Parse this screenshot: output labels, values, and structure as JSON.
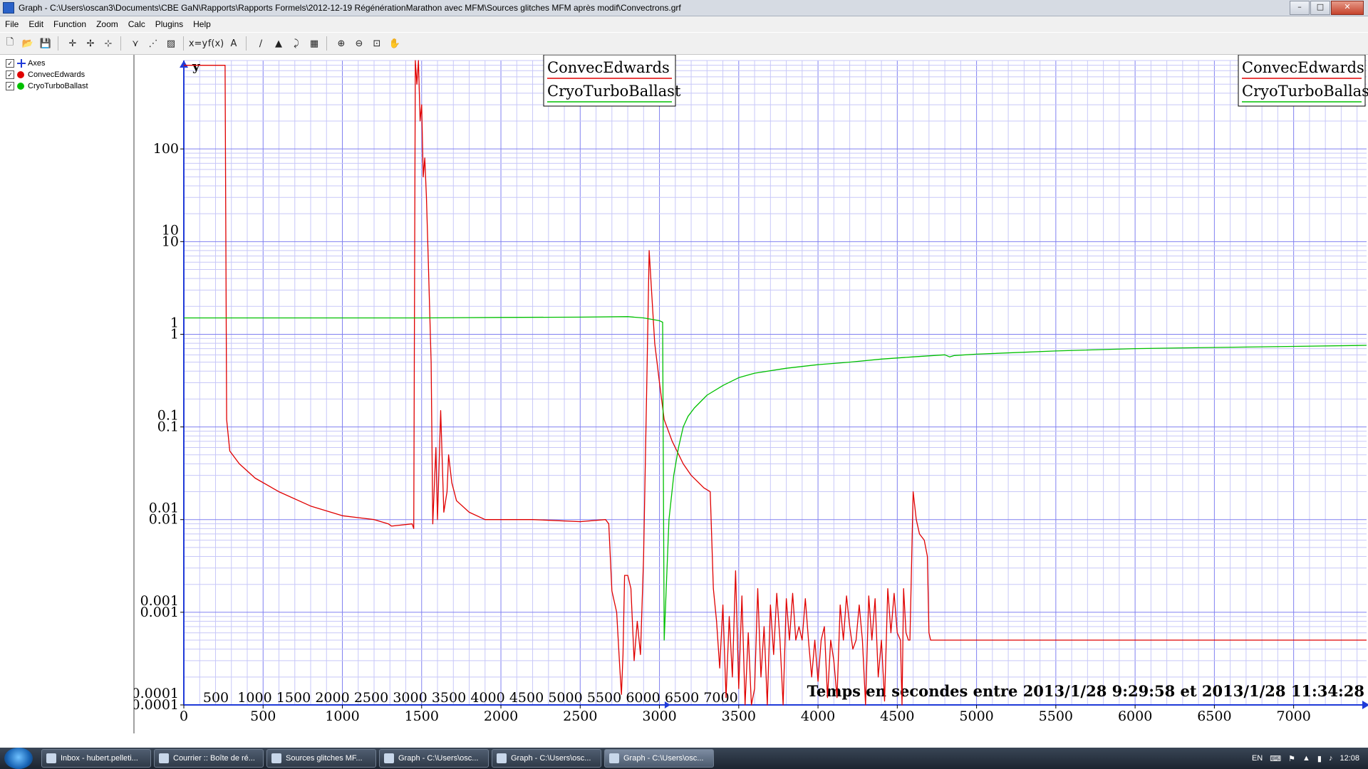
{
  "window": {
    "title": "Graph - C:\\Users\\oscan3\\Documents\\CBE GaN\\Rapports\\Rapports Formels\\2012-12-19 RégénérationMarathon avec MFM\\Sources glitches MFM après modif\\Convectrons.grf",
    "minimize": "–",
    "maximize": "□",
    "close": "✕"
  },
  "menu": [
    "File",
    "Edit",
    "Function",
    "Zoom",
    "Calc",
    "Plugins",
    "Help"
  ],
  "toolbar": {
    "groups": [
      [
        {
          "icon": "new-file-icon",
          "glyph": "🗋"
        },
        {
          "icon": "open-file-icon",
          "glyph": "📂"
        },
        {
          "icon": "save-icon",
          "glyph": "💾"
        }
      ],
      [
        {
          "icon": "insert-function-icon",
          "glyph": "✛"
        },
        {
          "icon": "insert-tangent-icon",
          "glyph": "✢"
        },
        {
          "icon": "insert-point-series-icon",
          "glyph": "⊹"
        }
      ],
      [
        {
          "icon": "edit-icon",
          "glyph": "⋎"
        },
        {
          "icon": "delete-icon",
          "glyph": "⋰"
        },
        {
          "icon": "shade-icon",
          "glyph": "▨"
        }
      ],
      [
        {
          "icon": "evaluate-icon",
          "glyph": "x=y"
        },
        {
          "icon": "table-icon",
          "glyph": "f(x)"
        },
        {
          "icon": "label-icon",
          "glyph": "A"
        }
      ],
      [
        {
          "icon": "trendline-icon",
          "glyph": "∕"
        },
        {
          "icon": "area-icon",
          "glyph": "▲"
        },
        {
          "icon": "measure-icon",
          "glyph": "⤸"
        },
        {
          "icon": "grid-table-icon",
          "glyph": "▦"
        }
      ],
      [
        {
          "icon": "zoom-in-icon",
          "glyph": "⊕"
        },
        {
          "icon": "zoom-out-icon",
          "glyph": "⊖"
        },
        {
          "icon": "zoom-square-icon",
          "glyph": "⊡"
        },
        {
          "icon": "move-hand-icon",
          "glyph": "✋"
        }
      ]
    ]
  },
  "function_list": [
    {
      "label": "Axes",
      "checked": true,
      "marker": "axes",
      "color": "#1f3ad8"
    },
    {
      "label": "ConvecEdwards",
      "checked": true,
      "marker": "dot",
      "color": "#e00000"
    },
    {
      "label": "CryoTurboBallast",
      "checked": true,
      "marker": "dot",
      "color": "#00c000"
    }
  ],
  "chart_data": {
    "type": "line",
    "y_axis_name": "y",
    "y_scale": "log",
    "ylim": [
      0.0001,
      900
    ],
    "xlim": [
      0,
      7460
    ],
    "x_ticks": [
      0,
      500,
      1000,
      1500,
      2000,
      2500,
      3000,
      3500,
      4000,
      4500,
      5000,
      5500,
      6000,
      6500,
      7000
    ],
    "y_tick_labels": [
      "100",
      "10",
      "1",
      "0.1",
      "0.01",
      "0.001",
      "0.0001"
    ],
    "ghost_x_ticks": [
      500,
      1000,
      1500,
      2000,
      2500,
      3000,
      3500,
      4000,
      4500,
      5000,
      5500,
      6000,
      6500,
      7000
    ],
    "ghost_y_tick_labels": [
      "10",
      "1",
      "0.1",
      "0.01",
      "0.001",
      "0.0001"
    ],
    "xlabel": "Temps en secondes entre 2013/1/28 9:29:58 et 2013/1/28 11:34:28",
    "grid": true,
    "legend": [
      "top-center",
      "top-right"
    ],
    "series": [
      {
        "name": "ConvecEdwards",
        "color": "#e00000",
        "points": [
          [
            0,
            800
          ],
          [
            250,
            800
          ],
          [
            260,
            800
          ],
          [
            270,
            0.12
          ],
          [
            290,
            0.055
          ],
          [
            350,
            0.04
          ],
          [
            450,
            0.028
          ],
          [
            600,
            0.02
          ],
          [
            800,
            0.014
          ],
          [
            1000,
            0.011
          ],
          [
            1200,
            0.01
          ],
          [
            1290,
            0.009
          ],
          [
            1310,
            0.0085
          ],
          [
            1440,
            0.009
          ],
          [
            1450,
            0.008
          ],
          [
            1460,
            900
          ],
          [
            1470,
            500
          ],
          [
            1480,
            900
          ],
          [
            1490,
            200
          ],
          [
            1500,
            300
          ],
          [
            1510,
            50
          ],
          [
            1520,
            80
          ],
          [
            1530,
            30
          ],
          [
            1540,
            8
          ],
          [
            1560,
            0.5
          ],
          [
            1570,
            0.009
          ],
          [
            1590,
            0.06
          ],
          [
            1600,
            0.01
          ],
          [
            1620,
            0.15
          ],
          [
            1640,
            0.012
          ],
          [
            1660,
            0.02
          ],
          [
            1670,
            0.05
          ],
          [
            1690,
            0.025
          ],
          [
            1720,
            0.016
          ],
          [
            1800,
            0.012
          ],
          [
            1900,
            0.01
          ],
          [
            2200,
            0.01
          ],
          [
            2500,
            0.0095
          ],
          [
            2660,
            0.01
          ],
          [
            2680,
            0.009
          ],
          [
            2700,
            0.0017
          ],
          [
            2730,
            0.001
          ],
          [
            2750,
            0.00025
          ],
          [
            2760,
            0.00013
          ],
          [
            2770,
            0.00035
          ],
          [
            2780,
            0.0025
          ],
          [
            2800,
            0.0025
          ],
          [
            2820,
            0.0018
          ],
          [
            2840,
            0.0003
          ],
          [
            2860,
            0.0008
          ],
          [
            2880,
            0.00035
          ],
          [
            2900,
            0.004
          ],
          [
            2920,
            0.3
          ],
          [
            2935,
            8
          ],
          [
            2950,
            3
          ],
          [
            2970,
            0.8
          ],
          [
            3000,
            0.3
          ],
          [
            3030,
            0.12
          ],
          [
            3080,
            0.07
          ],
          [
            3150,
            0.04
          ],
          [
            3200,
            0.03
          ],
          [
            3280,
            0.022
          ],
          [
            3320,
            0.02
          ],
          [
            3340,
            0.0018
          ],
          [
            3360,
            0.0008
          ],
          [
            3380,
            0.00025
          ],
          [
            3400,
            0.0012
          ],
          [
            3420,
            0.00012
          ],
          [
            3440,
            0.0009
          ],
          [
            3460,
            0.0002
          ],
          [
            3480,
            0.0028
          ],
          [
            3500,
            0.00015
          ],
          [
            3520,
            0.0015
          ],
          [
            3540,
            0.0001
          ],
          [
            3560,
            0.0006
          ],
          [
            3580,
            0.0001
          ],
          [
            3600,
            0.00015
          ],
          [
            3620,
            0.0018
          ],
          [
            3640,
            0.0002
          ],
          [
            3660,
            0.0007
          ],
          [
            3680,
            0.0001
          ],
          [
            3700,
            0.0012
          ],
          [
            3720,
            0.00035
          ],
          [
            3740,
            0.0016
          ],
          [
            3760,
            0.0005
          ],
          [
            3780,
            0.0001
          ],
          [
            3800,
            0.0014
          ],
          [
            3820,
            0.0005
          ],
          [
            3840,
            0.0016
          ],
          [
            3860,
            0.0005
          ],
          [
            3880,
            0.0007
          ],
          [
            3900,
            0.0005
          ],
          [
            3920,
            0.0014
          ],
          [
            3940,
            0.0005
          ],
          [
            3960,
            0.0002
          ],
          [
            3980,
            0.0005
          ],
          [
            4000,
            0.00018
          ],
          [
            4020,
            0.0005
          ],
          [
            4040,
            0.0007
          ],
          [
            4060,
            0.00012
          ],
          [
            4080,
            0.0005
          ],
          [
            4100,
            0.0003
          ],
          [
            4120,
            0.00012
          ],
          [
            4140,
            0.0012
          ],
          [
            4160,
            0.0005
          ],
          [
            4180,
            0.0015
          ],
          [
            4200,
            0.0007
          ],
          [
            4220,
            0.0004
          ],
          [
            4240,
            0.0005
          ],
          [
            4260,
            0.0012
          ],
          [
            4280,
            0.0005
          ],
          [
            4300,
            0.0001
          ],
          [
            4320,
            0.0015
          ],
          [
            4340,
            0.0005
          ],
          [
            4360,
            0.0014
          ],
          [
            4380,
            0.0002
          ],
          [
            4400,
            0.0005
          ],
          [
            4420,
            0.00011
          ],
          [
            4440,
            0.0018
          ],
          [
            4460,
            0.0006
          ],
          [
            4480,
            0.0016
          ],
          [
            4500,
            0.0006
          ],
          [
            4520,
            0.0005
          ],
          [
            4530,
            0.0001
          ],
          [
            4540,
            0.0018
          ],
          [
            4555,
            0.0006
          ],
          [
            4570,
            0.0005
          ],
          [
            4580,
            0.0005
          ],
          [
            4600,
            0.02
          ],
          [
            4620,
            0.01
          ],
          [
            4640,
            0.007
          ],
          [
            4670,
            0.006
          ],
          [
            4690,
            0.004
          ],
          [
            4700,
            0.0006
          ],
          [
            4710,
            0.0005
          ],
          [
            7460,
            0.0005
          ]
        ]
      },
      {
        "name": "CryoTurboBallast",
        "color": "#00c000",
        "points": [
          [
            0,
            1.5
          ],
          [
            500,
            1.5
          ],
          [
            1000,
            1.5
          ],
          [
            1500,
            1.5
          ],
          [
            2000,
            1.52
          ],
          [
            2500,
            1.53
          ],
          [
            2800,
            1.55
          ],
          [
            2900,
            1.5
          ],
          [
            3000,
            1.4
          ],
          [
            3020,
            1.35
          ],
          [
            3030,
            0.0005
          ],
          [
            3060,
            0.01
          ],
          [
            3090,
            0.03
          ],
          [
            3120,
            0.06
          ],
          [
            3150,
            0.1
          ],
          [
            3180,
            0.13
          ],
          [
            3220,
            0.16
          ],
          [
            3300,
            0.22
          ],
          [
            3400,
            0.28
          ],
          [
            3500,
            0.34
          ],
          [
            3600,
            0.38
          ],
          [
            3800,
            0.43
          ],
          [
            4000,
            0.47
          ],
          [
            4200,
            0.5
          ],
          [
            4400,
            0.54
          ],
          [
            4600,
            0.57
          ],
          [
            4800,
            0.6
          ],
          [
            4830,
            0.57
          ],
          [
            4860,
            0.59
          ],
          [
            5000,
            0.61
          ],
          [
            5500,
            0.66
          ],
          [
            6000,
            0.7
          ],
          [
            6500,
            0.72
          ],
          [
            7000,
            0.74
          ],
          [
            7460,
            0.76
          ]
        ]
      }
    ]
  },
  "taskbar": {
    "items": [
      {
        "label": "Inbox - hubert.pelleti...",
        "active": false
      },
      {
        "label": "Courrier :: Boîte de ré...",
        "active": false
      },
      {
        "label": "Sources glitches MF...",
        "active": false
      },
      {
        "label": "Graph - C:\\Users\\osc...",
        "active": false
      },
      {
        "label": "Graph - C:\\Users\\osc...",
        "active": false
      },
      {
        "label": "Graph - C:\\Users\\osc...",
        "active": true
      }
    ],
    "language": "EN",
    "clock": "12:08"
  }
}
